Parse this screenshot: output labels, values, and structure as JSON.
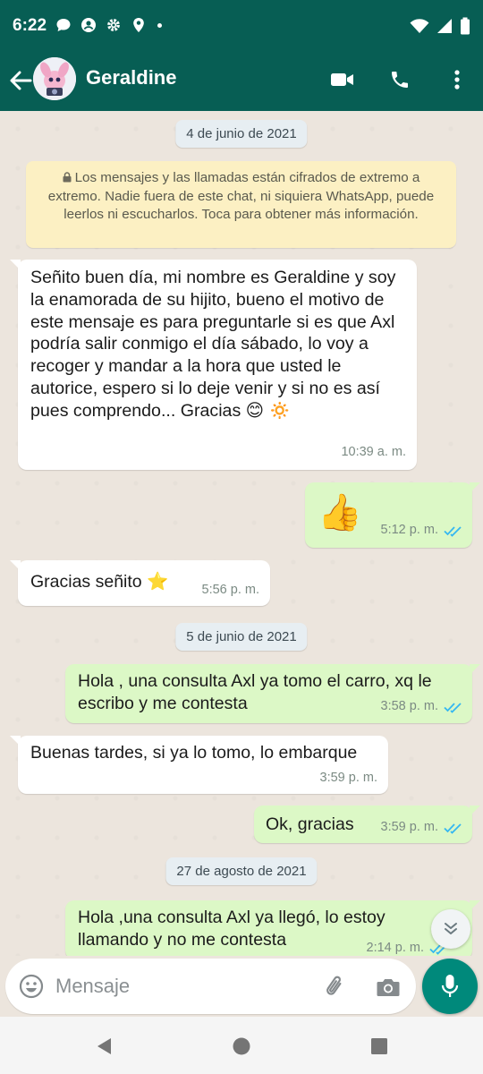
{
  "status_bar": {
    "time": "6:22"
  },
  "header": {
    "contact_name": "Geraldine"
  },
  "notice": {
    "text": "Los mensajes y las llamadas están cifrados de extremo a extremo. Nadie fuera de este chat, ni siquiera WhatsApp, puede leerlos ni escucharlos. Toca para obtener más información."
  },
  "dates": [
    "4 de junio de 2021",
    "5 de junio de 2021",
    "27 de agosto de 2021"
  ],
  "messages": [
    {
      "direction": "in",
      "text": "Señito buen día, mi nombre es Geraldine y soy la enamorada de su hijito, bueno el motivo de este mensaje es para preguntarle si es que Axl podría salir conmigo el día sábado, lo voy a recoger y mandar a la hora que usted le autorice, espero si lo deje venir y si no es así pues comprendo... Gracias 😊 🔅",
      "time": "10:39 a. m."
    },
    {
      "direction": "out",
      "text": "👍",
      "time": "5:12 p. m."
    },
    {
      "direction": "in",
      "text": "Gracias señito ⭐",
      "time": "5:56 p. m."
    },
    {
      "direction": "out",
      "text": "Hola , una consulta Axl ya tomo el carro, xq le escribo y me contesta",
      "time": "3:58 p. m."
    },
    {
      "direction": "in",
      "text": "Buenas tardes, si ya lo tomo, lo embarque",
      "time": "3:59 p. m."
    },
    {
      "direction": "out",
      "text": "Ok, gracias",
      "time": "3:59 p. m."
    },
    {
      "direction": "out",
      "text": "Hola ,una consulta Axl ya llegó, lo estoy llamando y no me contesta",
      "time": "2:14 p. m."
    }
  ],
  "composer": {
    "placeholder": "Mensaje"
  },
  "colors": {
    "header": "#075e54",
    "outgoing_bubble": "#dcf8c6",
    "incoming_bubble": "#ffffff",
    "mic_button": "#00897b",
    "read_ticks": "#34b7f1"
  }
}
